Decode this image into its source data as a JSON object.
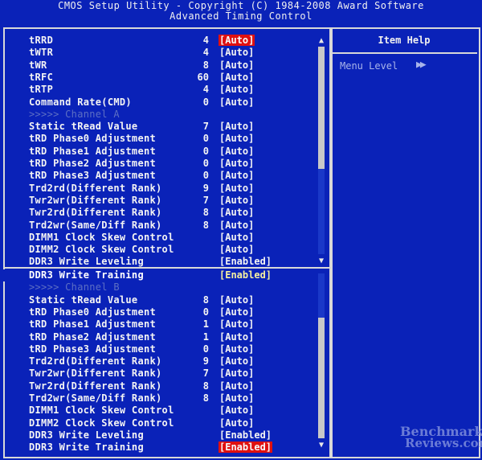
{
  "header": {
    "line1": "CMOS Setup Utility - Copyright (C) 1984-2008 Award Software",
    "line2": "Advanced Timing Control"
  },
  "help": {
    "title": "Item Help",
    "menu_level": "Menu Level",
    "menu_arrow": "▶▶"
  },
  "panel1": [
    {
      "label": "tRRD",
      "num": "4",
      "value": "[Auto]",
      "style": "hl"
    },
    {
      "label": "tWTR",
      "num": "4",
      "value": "[Auto]",
      "style": ""
    },
    {
      "label": "tWR",
      "num": "8",
      "value": "[Auto]",
      "style": ""
    },
    {
      "label": "tRFC",
      "num": "60",
      "value": "[Auto]",
      "style": ""
    },
    {
      "label": "tRTP",
      "num": "4",
      "value": "[Auto]",
      "style": ""
    },
    {
      "label": "Command Rate(CMD)",
      "num": "0",
      "value": "[Auto]",
      "style": ""
    },
    {
      "label": ">>>>> Channel A",
      "num": "",
      "value": "",
      "style": "dim"
    },
    {
      "label": "Static tRead Value",
      "num": "7",
      "value": "[Auto]",
      "style": ""
    },
    {
      "label": "tRD Phase0 Adjustment",
      "num": "0",
      "value": "[Auto]",
      "style": ""
    },
    {
      "label": "tRD Phase1 Adjustment",
      "num": "0",
      "value": "[Auto]",
      "style": ""
    },
    {
      "label": "tRD Phase2 Adjustment",
      "num": "0",
      "value": "[Auto]",
      "style": ""
    },
    {
      "label": "tRD Phase3 Adjustment",
      "num": "0",
      "value": "[Auto]",
      "style": ""
    },
    {
      "label": "Trd2rd(Different Rank)",
      "num": "9",
      "value": "[Auto]",
      "style": ""
    },
    {
      "label": "Twr2wr(Different Rank)",
      "num": "7",
      "value": "[Auto]",
      "style": ""
    },
    {
      "label": "Twr2rd(Different Rank)",
      "num": "8",
      "value": "[Auto]",
      "style": ""
    },
    {
      "label": "Trd2wr(Same/Diff Rank)",
      "num": "8",
      "value": "[Auto]",
      "style": ""
    },
    {
      "label": "DIMM1 Clock Skew Control",
      "num": "",
      "value": "[Auto]",
      "style": ""
    },
    {
      "label": "DIMM2 Clock Skew Control",
      "num": "",
      "value": "[Auto]",
      "style": ""
    },
    {
      "label": "DDR3 Write Leveling",
      "num": "",
      "value": "[Enabled]",
      "style": ""
    }
  ],
  "panel2": [
    {
      "label": "DDR3 Write Training",
      "num": "",
      "value": "[Enabled]",
      "style": "sel"
    },
    {
      "label": ">>>>> Channel B",
      "num": "",
      "value": "",
      "style": "dim"
    },
    {
      "label": "Static tRead Value",
      "num": "8",
      "value": "[Auto]",
      "style": ""
    },
    {
      "label": "tRD Phase0 Adjustment",
      "num": "0",
      "value": "[Auto]",
      "style": ""
    },
    {
      "label": "tRD Phase1 Adjustment",
      "num": "1",
      "value": "[Auto]",
      "style": ""
    },
    {
      "label": "tRD Phase2 Adjustment",
      "num": "1",
      "value": "[Auto]",
      "style": ""
    },
    {
      "label": "tRD Phase3 Adjustment",
      "num": "0",
      "value": "[Auto]",
      "style": ""
    },
    {
      "label": "Trd2rd(Different Rank)",
      "num": "9",
      "value": "[Auto]",
      "style": ""
    },
    {
      "label": "Twr2wr(Different Rank)",
      "num": "7",
      "value": "[Auto]",
      "style": ""
    },
    {
      "label": "Twr2rd(Different Rank)",
      "num": "8",
      "value": "[Auto]",
      "style": ""
    },
    {
      "label": "Trd2wr(Same/Diff Rank)",
      "num": "8",
      "value": "[Auto]",
      "style": ""
    },
    {
      "label": "DIMM1 Clock Skew Control",
      "num": "",
      "value": "[Auto]",
      "style": ""
    },
    {
      "label": "DIMM2 Clock Skew Control",
      "num": "",
      "value": "[Auto]",
      "style": ""
    },
    {
      "label": "DDR3 Write Leveling",
      "num": "",
      "value": "[Enabled]",
      "style": ""
    },
    {
      "label": "DDR3 Write Training",
      "num": "",
      "value": "[Enabled]",
      "style": "hl"
    }
  ],
  "scroll_arrows": {
    "up": "▲",
    "down": "▼"
  },
  "watermark": {
    "line1": "Benchmark",
    "line2": "Reviews.com"
  },
  "colors": {
    "background": "#0a22b8",
    "highlight": "#e01010",
    "selected_value": "#f6f0a0",
    "dim_text": "#5d6fc4"
  }
}
